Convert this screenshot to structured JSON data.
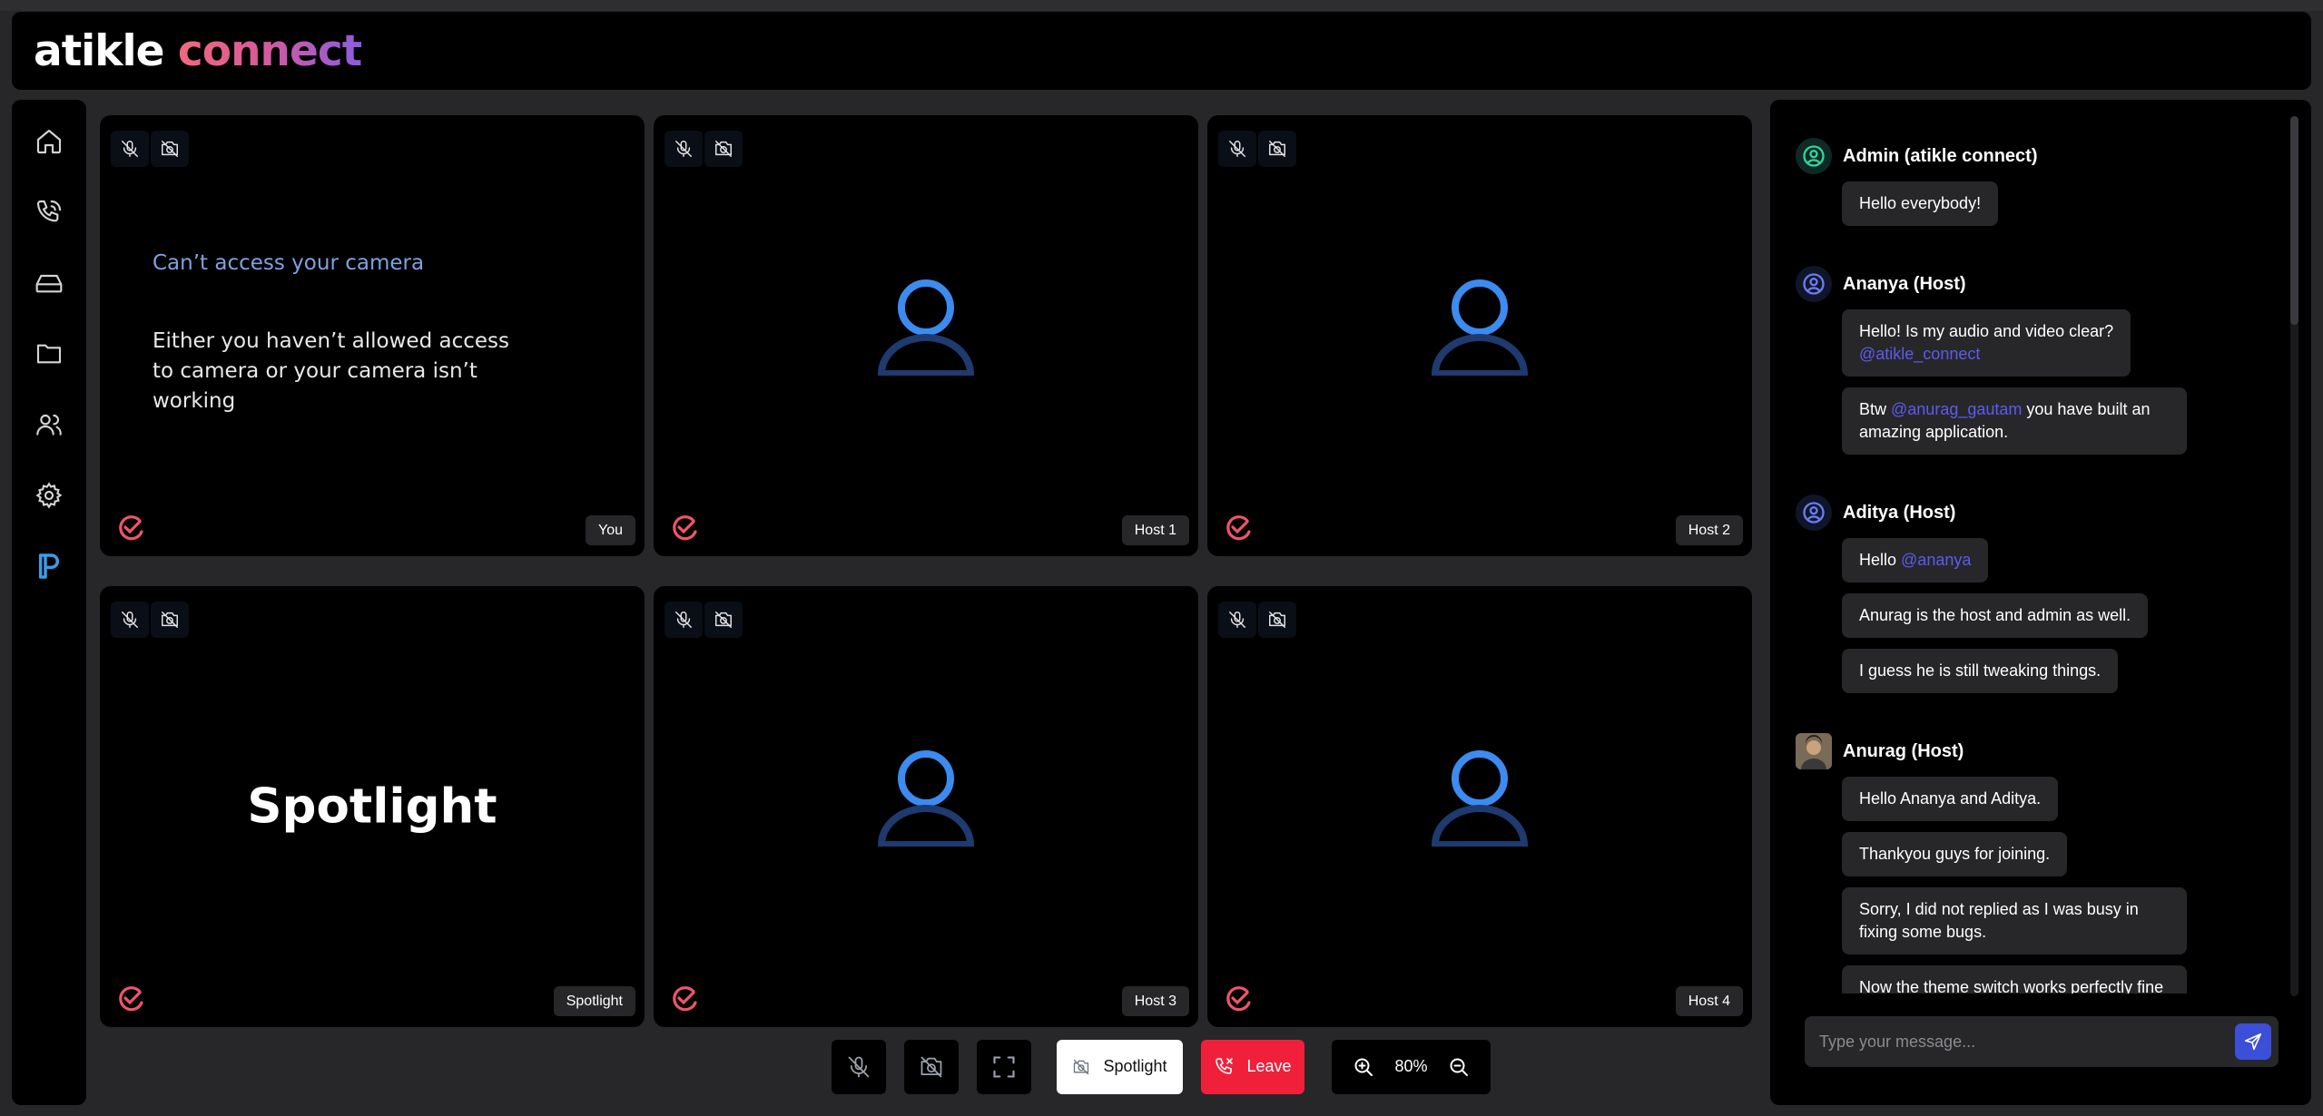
{
  "app": {
    "brand_part1": "atikle",
    "brand_part2": "connect"
  },
  "sidebar": {
    "items": [
      {
        "icon": "home-icon"
      },
      {
        "icon": "phone-call-icon"
      },
      {
        "icon": "hard-drive-icon"
      },
      {
        "icon": "folder-icon"
      },
      {
        "icon": "users-icon"
      },
      {
        "icon": "settings-icon"
      },
      {
        "icon": "payment-icon"
      }
    ]
  },
  "tiles": [
    {
      "label": "You",
      "camera_error_title": "Can’t access your camera",
      "camera_error_body": "Either you haven’t allowed access to camera or your camera isn’t working"
    },
    {
      "label": "Host 1"
    },
    {
      "label": "Host 2"
    },
    {
      "label": "Spotlight",
      "center_text": "Spotlight"
    },
    {
      "label": "Host 3"
    },
    {
      "label": "Host 4"
    }
  ],
  "controls": {
    "spotlight_label": "Spotlight",
    "leave_label": "Leave",
    "zoom_level": "80%"
  },
  "chat": {
    "groups": [
      {
        "name": "Admin (atikle connect)",
        "messages": [
          {
            "text": "Hello everybody!"
          }
        ]
      },
      {
        "name": "Ananya (Host)",
        "messages": [
          {
            "pre": "Hello! Is my audio and video clear?",
            "mention": "@atikle_connect",
            "post": ""
          },
          {
            "pre": "Btw ",
            "mention": "@anurag_gautam",
            "post": " you have built an amazing application."
          }
        ]
      },
      {
        "name": "Aditya (Host)",
        "messages": [
          {
            "pre": "Hello ",
            "mention": "@ananya",
            "post": ""
          },
          {
            "text": "Anurag is the host and admin as well."
          },
          {
            "text": "I guess he is still tweaking things."
          }
        ]
      },
      {
        "name": "Anurag (Host)",
        "messages": [
          {
            "text": "Hello Ananya and Aditya."
          },
          {
            "text": "Thankyou guys for joining."
          },
          {
            "text": "Sorry, I did not replied as I was busy in fixing some bugs."
          },
          {
            "text": "Now the theme switch works perfectly fine and it adapts the theme automatically."
          }
        ]
      }
    ],
    "input_placeholder": "Type your message..."
  },
  "colors": {
    "accent_blue": "#3b82f6",
    "leave_red": "#f0203a",
    "send_blue": "#3b4fd8",
    "mention": "#5b5bf0"
  }
}
